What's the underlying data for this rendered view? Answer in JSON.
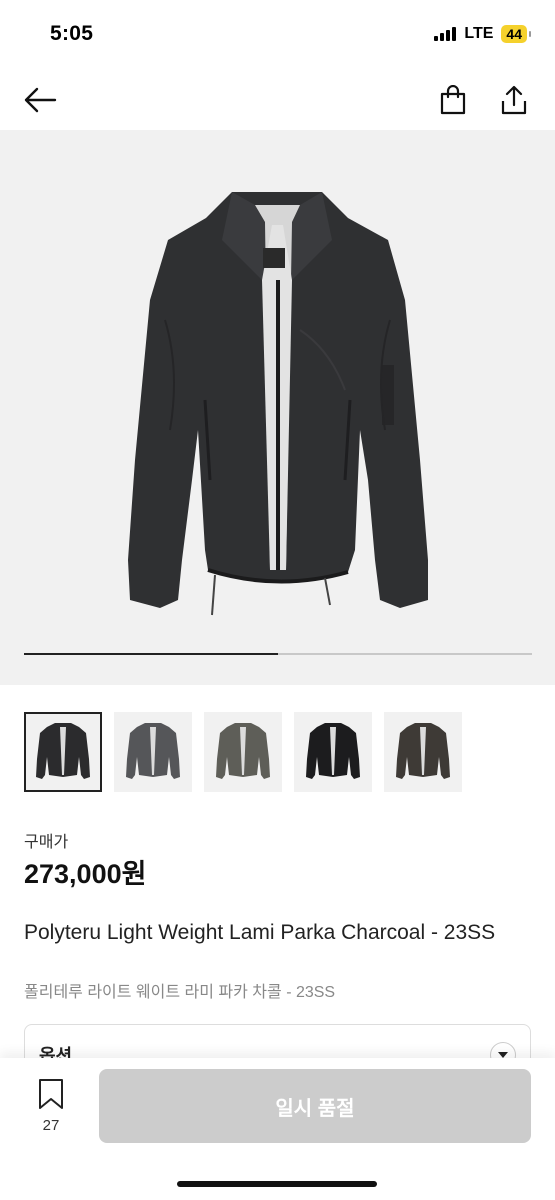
{
  "status_bar": {
    "time": "5:05",
    "network": "LTE",
    "battery": "44"
  },
  "nav": {
    "back_icon": "arrow-left-icon",
    "bag_icon": "shopping-bag-icon",
    "share_icon": "share-icon"
  },
  "gallery": {
    "progress": 0.5,
    "thumbnails": [
      {
        "color": "#2b2b2d"
      },
      {
        "color": "#555659"
      },
      {
        "color": "#5e5e58"
      },
      {
        "color": "#1c1c1e"
      },
      {
        "color": "#3e3a36"
      }
    ]
  },
  "product": {
    "price_label": "구매가",
    "price": "273,000원",
    "title_en": "Polyteru Light Weight Lami Parka Charcoal - 23SS",
    "title_ko": "폴리테루 라이트 웨이트 라미 파카 차콜 - 23SS"
  },
  "option": {
    "label": "옵션",
    "chevron_icon": "chevron-down-icon"
  },
  "bottom": {
    "wish_count": "27",
    "wish_icon": "bookmark-icon",
    "cta_label": "일시 품절"
  },
  "colors": {
    "cta_disabled": "#cccccc",
    "battery": "#f5d12c"
  }
}
